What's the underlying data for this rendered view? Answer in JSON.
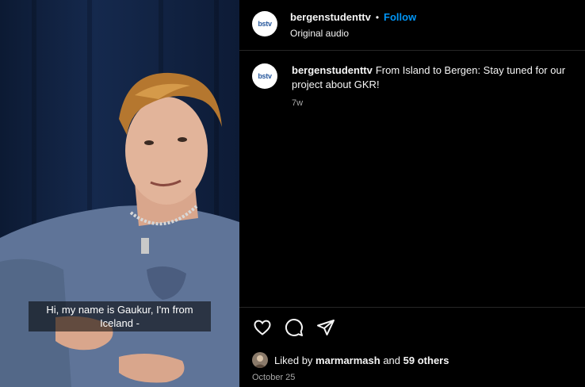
{
  "video": {
    "subtitle": "Hi, my name is Gaukur, I'm from\nIceland -"
  },
  "header": {
    "avatar_text": "bstv",
    "username": "bergenstudenttv",
    "separator": "•",
    "follow_label": "Follow",
    "audio_label": "Original audio"
  },
  "caption": {
    "avatar_text": "bstv",
    "username": "bergenstudenttv",
    "text": "From Island to Bergen: Stay tuned for our project about GKR!",
    "time": "7w"
  },
  "actions": {
    "icons": [
      "heart-icon",
      "comment-icon",
      "share-icon"
    ]
  },
  "likes": {
    "prefix": "Liked by",
    "user": "marmarmash",
    "middle": "and",
    "others": "59 others"
  },
  "date": "October 25",
  "colors": {
    "background": "#000000",
    "accent": "#0095f6",
    "muted": "#a8a8a8",
    "divider": "#262626"
  }
}
